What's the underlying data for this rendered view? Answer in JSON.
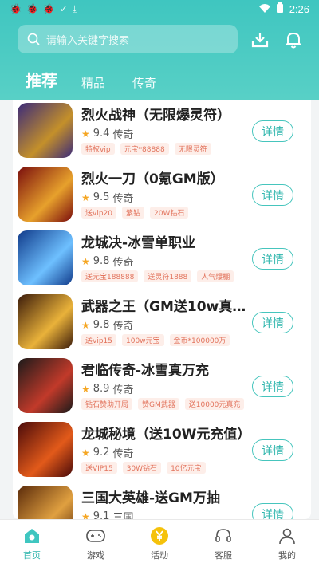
{
  "status": {
    "time": "2:26"
  },
  "search": {
    "placeholder": "请输入关键字搜索"
  },
  "tabs": [
    {
      "label": "推荐"
    },
    {
      "label": "精品"
    },
    {
      "label": "传奇"
    }
  ],
  "games": [
    {
      "title": "烈火战神（无限爆灵符）",
      "score": "9.4",
      "category": "传奇",
      "tags": [
        "特权vip",
        "元宝*88888",
        "无限灵符"
      ],
      "button": "详情",
      "colors": [
        "#3b2a7a",
        "#c4902a"
      ]
    },
    {
      "title": "烈火一刀（0氪GM版）",
      "score": "9.5",
      "category": "传奇",
      "tags": [
        "送vip20",
        "紫钻",
        "20W钻石"
      ],
      "button": "详情",
      "colors": [
        "#7a0d0d",
        "#e7a12c"
      ]
    },
    {
      "title": "龙城决-冰雪单职业",
      "score": "9.8",
      "category": "传奇",
      "tags": [
        "送元宝188888",
        "送灵符1888",
        "人气爆棚"
      ],
      "button": "详情",
      "colors": [
        "#103a8a",
        "#6ec0ff"
      ]
    },
    {
      "title": "武器之王（GM送10w真充...",
      "score": "9.8",
      "category": "传奇",
      "tags": [
        "送vip15",
        "100w元宝",
        "金币*100000万"
      ],
      "button": "详情",
      "colors": [
        "#3a1a0a",
        "#e9b23a"
      ]
    },
    {
      "title": "君临传奇-冰雪真万充",
      "score": "8.9",
      "category": "传奇",
      "tags": [
        "钻石赞助开局",
        "赞GM武器",
        "送10000元真充"
      ],
      "button": "详情",
      "colors": [
        "#1a1a1a",
        "#c23a2a"
      ]
    },
    {
      "title": "龙城秘境（送10W元充值）",
      "score": "9.2",
      "category": "传奇",
      "tags": [
        "送VIP15",
        "30W钻石",
        "10亿元宝"
      ],
      "button": "详情",
      "colors": [
        "#4a0a0a",
        "#e25a1a"
      ]
    },
    {
      "title": "三国大英雄-送GM万抽",
      "score": "9.1",
      "category": "三国",
      "tags": [],
      "button": "详情",
      "colors": [
        "#5a2a0a",
        "#e0a040"
      ]
    }
  ],
  "nav": [
    {
      "label": "首页"
    },
    {
      "label": "游戏"
    },
    {
      "label": "活动"
    },
    {
      "label": "客服"
    },
    {
      "label": "我的"
    }
  ],
  "accent": "#3fc6c0"
}
